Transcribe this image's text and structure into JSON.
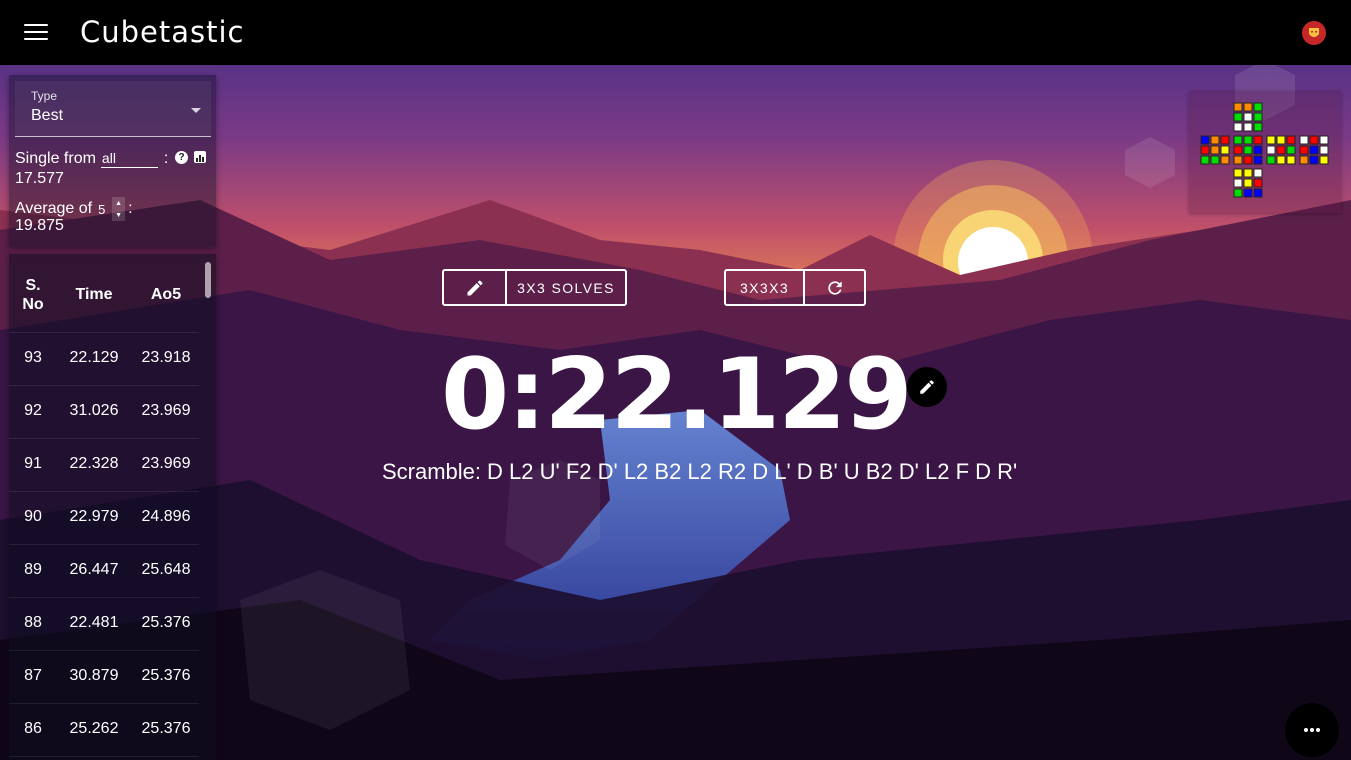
{
  "app": {
    "title": "Cubetastic"
  },
  "stats": {
    "type_label": "Type",
    "type_value": "Best",
    "single_label": "Single from",
    "single_input_value": "all",
    "colon": ":",
    "single_value": "17.577",
    "average_label": "Average of",
    "average_input_value": "5",
    "average_value": "19.875"
  },
  "history": {
    "columns": {
      "no_line1": "S.",
      "no_line2": "No",
      "time": "Time",
      "ao5": "Ao5"
    },
    "rows": [
      {
        "no": "93",
        "time": "22.129",
        "ao5": "23.918"
      },
      {
        "no": "92",
        "time": "31.026",
        "ao5": "23.969"
      },
      {
        "no": "91",
        "time": "22.328",
        "ao5": "23.969"
      },
      {
        "no": "90",
        "time": "22.979",
        "ao5": "24.896"
      },
      {
        "no": "89",
        "time": "26.447",
        "ao5": "25.648"
      },
      {
        "no": "88",
        "time": "22.481",
        "ao5": "25.376"
      },
      {
        "no": "87",
        "time": "30.879",
        "ao5": "25.376"
      },
      {
        "no": "86",
        "time": "25.262",
        "ao5": "25.376"
      }
    ]
  },
  "session": {
    "edit_icon": "pencil-icon",
    "name": "3X3 SOLVES"
  },
  "puzzle": {
    "name": "3X3X3",
    "refresh_icon": "refresh-icon"
  },
  "timer": {
    "display": "0:22.129"
  },
  "scramble": {
    "label": "Scramble:",
    "moves": "D L2 U' F2 D' L2 B2 L2 R2 D L' D B' U B2 D' L2 F D R'"
  },
  "cube_net": {
    "colors": {
      "W": "#ffffff",
      "Y": "#ffff00",
      "R": "#ff0000",
      "O": "#ff8c00",
      "G": "#00dd00",
      "B": "#0000ff"
    },
    "faces": {
      "U": [
        "O",
        "O",
        "G",
        "G",
        "W",
        "G",
        "W",
        "W",
        "G"
      ],
      "L": [
        "B",
        "O",
        "R",
        "R",
        "O",
        "Y",
        "G",
        "G",
        "O"
      ],
      "F": [
        "G",
        "G",
        "R",
        "R",
        "G",
        "B",
        "O",
        "R",
        "B"
      ],
      "R": [
        "Y",
        "Y",
        "R",
        "W",
        "R",
        "G",
        "G",
        "Y",
        "Y"
      ],
      "B": [
        "W",
        "R",
        "W",
        "R",
        "B",
        "W",
        "O",
        "B",
        "Y"
      ],
      "D": [
        "Y",
        "Y",
        "W",
        "W",
        "Y",
        "R",
        "G",
        "B",
        "B"
      ]
    }
  },
  "fab": {
    "icon": "more-horizontal-icon"
  }
}
